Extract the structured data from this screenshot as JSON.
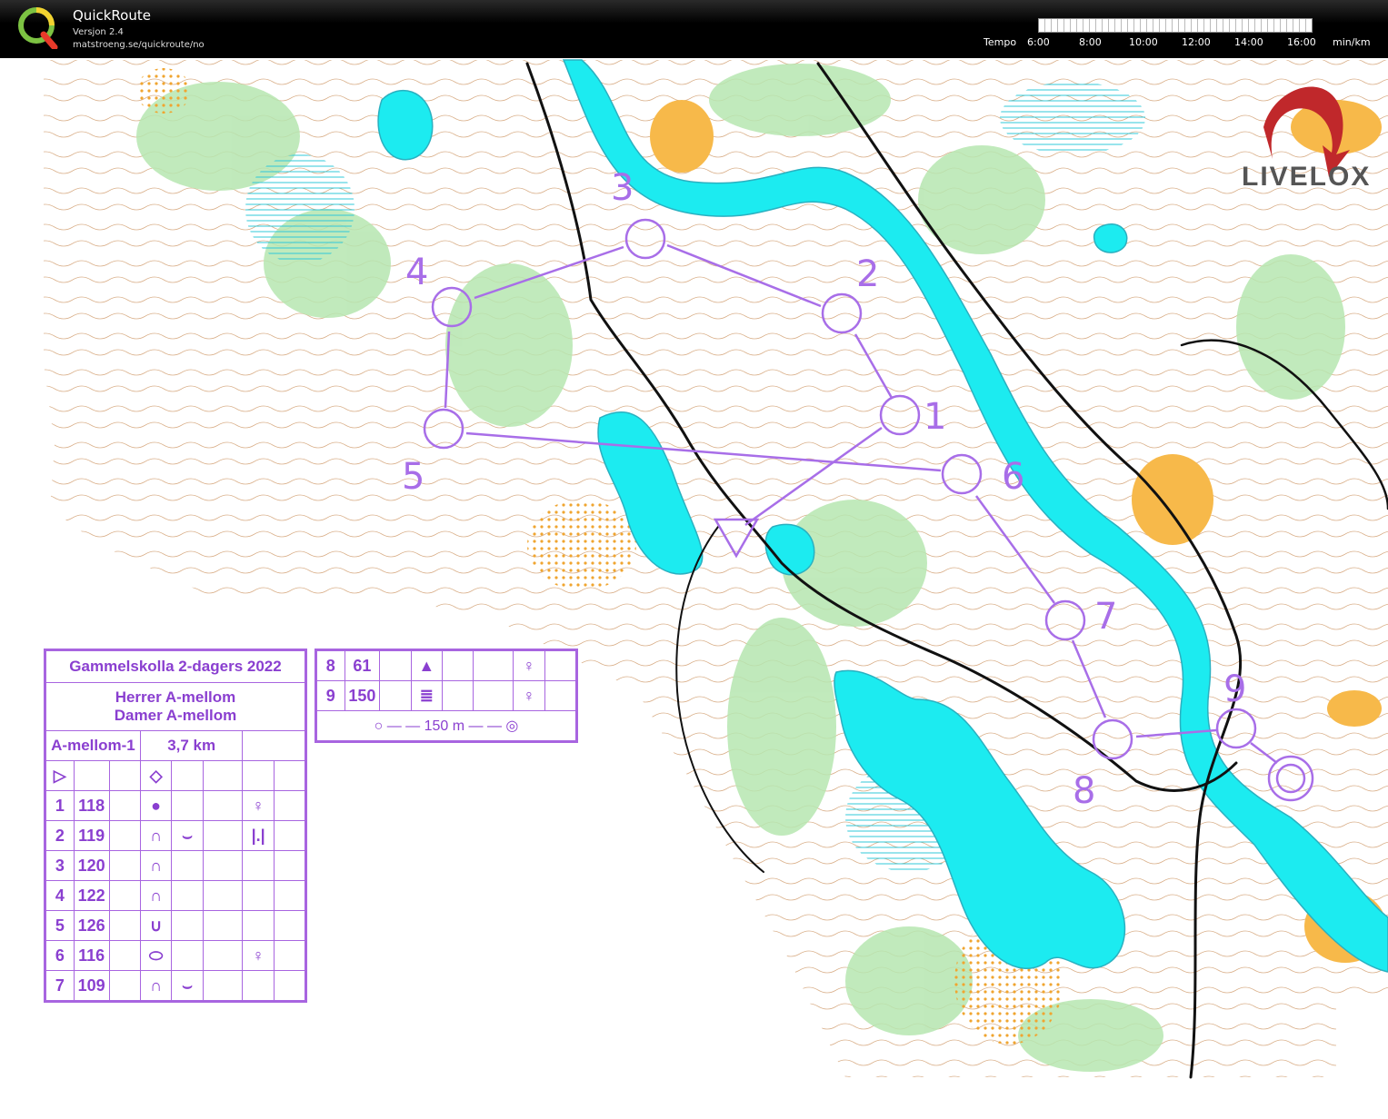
{
  "header": {
    "app_title": "QuickRoute",
    "app_version": "Versjon 2.4",
    "app_url": "matstroeng.se/quickroute/no",
    "tempo_label": "Tempo",
    "tempo_ticks": [
      "6:00",
      "8:00",
      "10:00",
      "12:00",
      "14:00",
      "16:00"
    ],
    "tempo_unit": "min/km"
  },
  "branding": {
    "livelox": "LIVELOX"
  },
  "course": {
    "event": "Gammelskolla 2-dagers 2022",
    "classes_line1": "Herrer A-mellom",
    "classes_line2": "Damer A-mellom",
    "course_name": "A-mellom-1",
    "length": "3,7 km",
    "controls": [
      {
        "num": "1",
        "code": "118"
      },
      {
        "num": "2",
        "code": "119"
      },
      {
        "num": "3",
        "code": "120"
      },
      {
        "num": "4",
        "code": "122"
      },
      {
        "num": "5",
        "code": "126"
      },
      {
        "num": "6",
        "code": "116"
      },
      {
        "num": "7",
        "code": "109"
      },
      {
        "num": "8",
        "code": "61"
      },
      {
        "num": "9",
        "code": "150"
      }
    ],
    "finish_distance": "150 m",
    "map_labels": [
      "1",
      "2",
      "3",
      "4",
      "5",
      "6",
      "7",
      "8",
      "9"
    ]
  },
  "colors": {
    "course": "#a86ee8",
    "water": "#1cebf0",
    "open_land": "#f7b94a",
    "vegetation": "#b6e6b0",
    "contour": "#b36b2c"
  }
}
